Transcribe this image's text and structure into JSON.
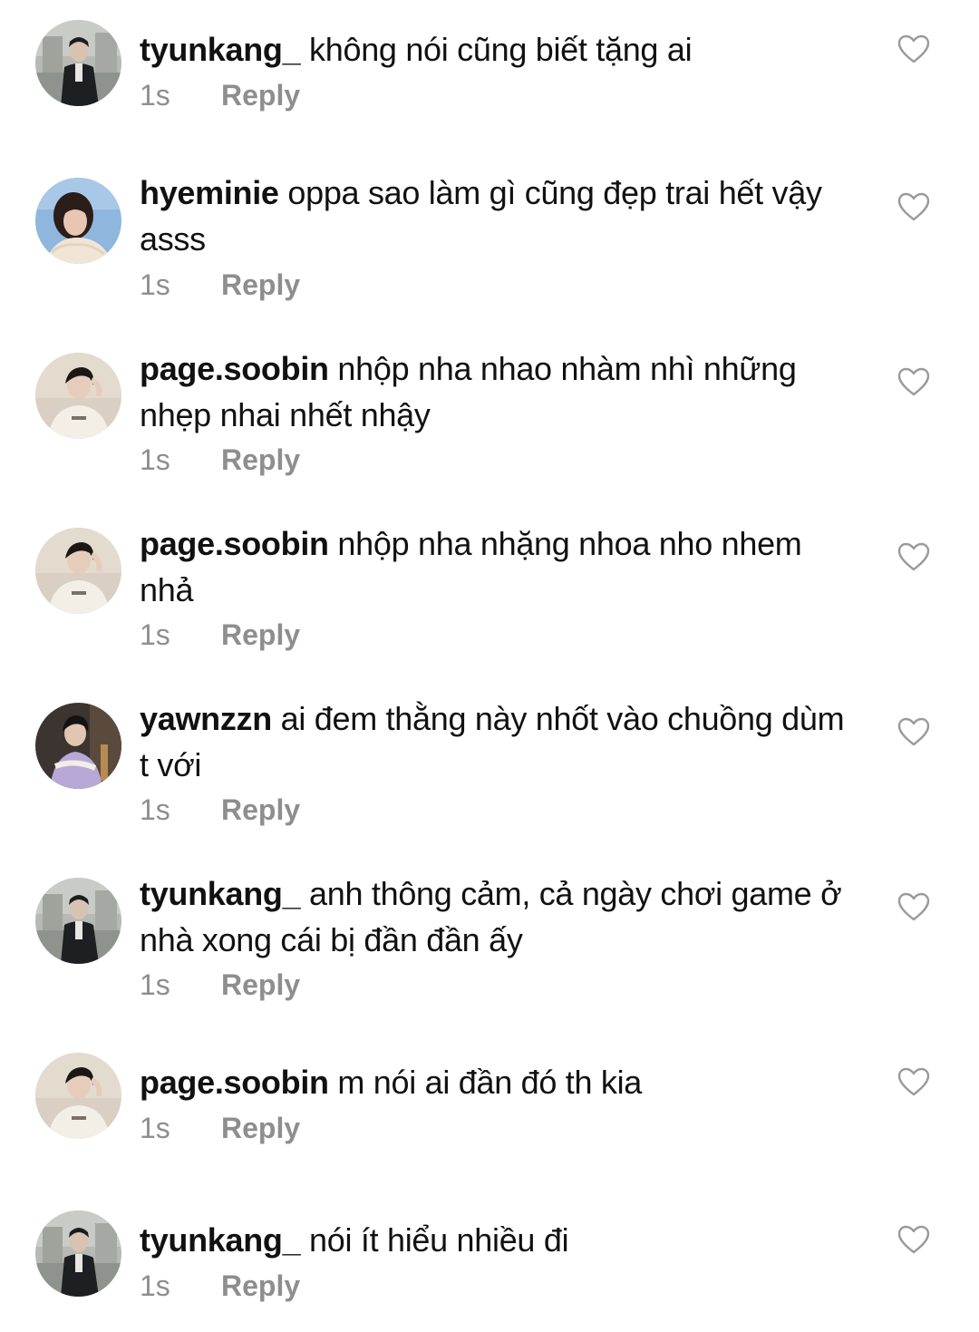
{
  "comments": [
    {
      "username": "tyunkang_",
      "text": "không nói cũng biết tặng ai",
      "time": "1s",
      "reply": "Reply",
      "avatar": "tyunkang-avatar"
    },
    {
      "username": "hyeminie",
      "text": "oppa sao làm gì cũng đẹp trai hết vậy asss",
      "time": "1s",
      "reply": "Reply",
      "avatar": "hyeminie-avatar"
    },
    {
      "username": "page.soobin",
      "text": "nhộp nha nhao nhàm nhì những nhẹp nhai nhết nhậy",
      "time": "1s",
      "reply": "Reply",
      "avatar": "soobin-avatar"
    },
    {
      "username": "page.soobin",
      "text": "nhộp nha nhặng nhoa nho nhem nhả",
      "time": "1s",
      "reply": "Reply",
      "avatar": "soobin-avatar"
    },
    {
      "username": "yawnzzn",
      "text": "ai đem thằng này nhốt vào chuồng dùm t với",
      "time": "1s",
      "reply": "Reply",
      "avatar": "yawnzzn-avatar"
    },
    {
      "username": "tyunkang_",
      "text": "anh thông cảm, cả ngày chơi game ở nhà xong cái bị đần đần ấy",
      "time": "1s",
      "reply": "Reply",
      "avatar": "tyunkang-avatar"
    },
    {
      "username": "page.soobin",
      "text": "m nói ai đần đó th kia",
      "time": "1s",
      "reply": "Reply",
      "avatar": "soobin-avatar"
    },
    {
      "username": "tyunkang_",
      "text": "nói ít hiểu nhiều đi",
      "time": "1s",
      "reply": "Reply",
      "avatar": "tyunkang-avatar"
    }
  ],
  "icons": {
    "like": "heart-outline-icon"
  },
  "colors": {
    "text": "#111111",
    "meta": "#8e8e8e",
    "heart": "#9a9a9a"
  }
}
